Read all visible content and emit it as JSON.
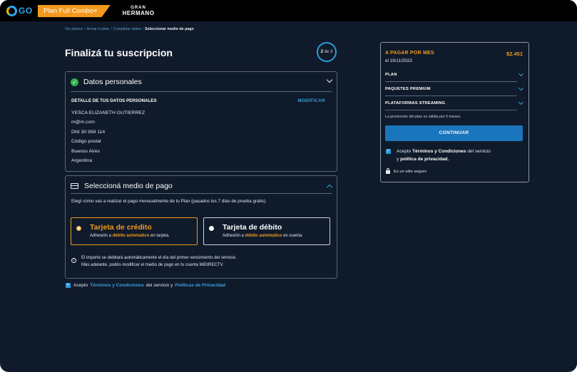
{
  "topbar": {
    "logo_text": "GO",
    "plan_tag": "Plan Full Combo+",
    "brand_line1": "GRAN",
    "brand_line2": "HERMANO"
  },
  "breadcrumb": {
    "items": [
      "Ver planes",
      "Armar tu plan",
      "Completar datos"
    ],
    "current": "Seleccionar medio de pago",
    "separator": "/"
  },
  "page": {
    "title": "Finalizá tu suscripcion",
    "step_current": "2",
    "step_rest": "de 3"
  },
  "personal": {
    "title": "Datos personales",
    "detail_heading": "DETALLE DE TUS DATOS PERSONALES",
    "modify_label": "MODIFICAR",
    "fields": [
      "YESCA ELIZANETH GUTIERREZ",
      "m@m.com",
      "DNI  30 958 114",
      "Código postal",
      "Buenos Aires",
      "Argentina"
    ]
  },
  "payment": {
    "title": "Seleccioná medio de pago",
    "intro": "Elegí cómo vas a realizar el pago mensualmente de tu Plan (pasados los 7 días de prueba gratis).",
    "options": [
      {
        "title": "Tarjeta de crédito",
        "sub_prefix": "Adhesión a ",
        "sub_highlight": "débito automatico",
        "sub_suffix": " en tarjeta."
      },
      {
        "title": "Tarjeta de débito",
        "sub_prefix": "Adhesión a ",
        "sub_highlight": "débito automatico",
        "sub_suffix": " en cuenta"
      }
    ],
    "info_line1": "El importe se debitará automáticamente el día del primer vencimiento del servicio.",
    "info_line2": "Más adelante, podés modificar el medio de pago en tu cuenta MiDIRECTV."
  },
  "terms": {
    "prefix": "Acepto",
    "link1": "Términos y Condiciones",
    "middle": "del servicio y",
    "link2": "Políticas de Privacidad"
  },
  "summary": {
    "pay_label": "A PAGAR POR MES",
    "amount": "$2.451",
    "date": "el 19/11/2023",
    "rows": [
      "PLAN",
      "PAQUETES PREMIUM",
      "PLATAFORMAS STREAMING"
    ],
    "promo": "La promoción del plan es válida por 6 meses.",
    "continue_label": "CONTINUAR",
    "terms_prefix": "Acepto ",
    "terms_bold1": "Términos y Condiciones",
    "terms_mid": " del servicio",
    "terms_line2_prefix": "y ",
    "terms_bold2": "política de privacidad.",
    "secure": "Es un sitio seguro"
  },
  "colors": {
    "background": "#0f1a2a",
    "accent_orange": "#f39a1e",
    "accent_blue": "#3aa0dc",
    "button_blue": "#1b75bc",
    "success_green": "#2fb24c"
  }
}
